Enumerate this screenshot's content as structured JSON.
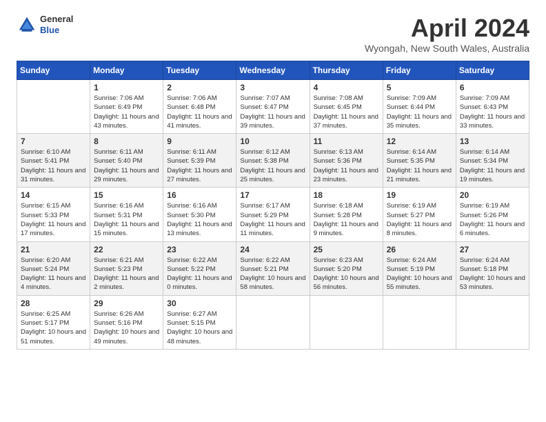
{
  "header": {
    "logo": {
      "general": "General",
      "blue": "Blue"
    },
    "title": "April 2024",
    "location": "Wyongah, New South Wales, Australia"
  },
  "weekdays": [
    "Sunday",
    "Monday",
    "Tuesday",
    "Wednesday",
    "Thursday",
    "Friday",
    "Saturday"
  ],
  "weeks": [
    [
      {
        "day": "",
        "empty": true
      },
      {
        "day": "1",
        "sunrise": "Sunrise: 7:06 AM",
        "sunset": "Sunset: 6:49 PM",
        "daylight": "Daylight: 11 hours and 43 minutes."
      },
      {
        "day": "2",
        "sunrise": "Sunrise: 7:06 AM",
        "sunset": "Sunset: 6:48 PM",
        "daylight": "Daylight: 11 hours and 41 minutes."
      },
      {
        "day": "3",
        "sunrise": "Sunrise: 7:07 AM",
        "sunset": "Sunset: 6:47 PM",
        "daylight": "Daylight: 11 hours and 39 minutes."
      },
      {
        "day": "4",
        "sunrise": "Sunrise: 7:08 AM",
        "sunset": "Sunset: 6:45 PM",
        "daylight": "Daylight: 11 hours and 37 minutes."
      },
      {
        "day": "5",
        "sunrise": "Sunrise: 7:09 AM",
        "sunset": "Sunset: 6:44 PM",
        "daylight": "Daylight: 11 hours and 35 minutes."
      },
      {
        "day": "6",
        "sunrise": "Sunrise: 7:09 AM",
        "sunset": "Sunset: 6:43 PM",
        "daylight": "Daylight: 11 hours and 33 minutes."
      }
    ],
    [
      {
        "day": "7",
        "sunrise": "Sunrise: 6:10 AM",
        "sunset": "Sunset: 5:41 PM",
        "daylight": "Daylight: 11 hours and 31 minutes."
      },
      {
        "day": "8",
        "sunrise": "Sunrise: 6:11 AM",
        "sunset": "Sunset: 5:40 PM",
        "daylight": "Daylight: 11 hours and 29 minutes."
      },
      {
        "day": "9",
        "sunrise": "Sunrise: 6:11 AM",
        "sunset": "Sunset: 5:39 PM",
        "daylight": "Daylight: 11 hours and 27 minutes."
      },
      {
        "day": "10",
        "sunrise": "Sunrise: 6:12 AM",
        "sunset": "Sunset: 5:38 PM",
        "daylight": "Daylight: 11 hours and 25 minutes."
      },
      {
        "day": "11",
        "sunrise": "Sunrise: 6:13 AM",
        "sunset": "Sunset: 5:36 PM",
        "daylight": "Daylight: 11 hours and 23 minutes."
      },
      {
        "day": "12",
        "sunrise": "Sunrise: 6:14 AM",
        "sunset": "Sunset: 5:35 PM",
        "daylight": "Daylight: 11 hours and 21 minutes."
      },
      {
        "day": "13",
        "sunrise": "Sunrise: 6:14 AM",
        "sunset": "Sunset: 5:34 PM",
        "daylight": "Daylight: 11 hours and 19 minutes."
      }
    ],
    [
      {
        "day": "14",
        "sunrise": "Sunrise: 6:15 AM",
        "sunset": "Sunset: 5:33 PM",
        "daylight": "Daylight: 11 hours and 17 minutes."
      },
      {
        "day": "15",
        "sunrise": "Sunrise: 6:16 AM",
        "sunset": "Sunset: 5:31 PM",
        "daylight": "Daylight: 11 hours and 15 minutes."
      },
      {
        "day": "16",
        "sunrise": "Sunrise: 6:16 AM",
        "sunset": "Sunset: 5:30 PM",
        "daylight": "Daylight: 11 hours and 13 minutes."
      },
      {
        "day": "17",
        "sunrise": "Sunrise: 6:17 AM",
        "sunset": "Sunset: 5:29 PM",
        "daylight": "Daylight: 11 hours and 11 minutes."
      },
      {
        "day": "18",
        "sunrise": "Sunrise: 6:18 AM",
        "sunset": "Sunset: 5:28 PM",
        "daylight": "Daylight: 11 hours and 9 minutes."
      },
      {
        "day": "19",
        "sunrise": "Sunrise: 6:19 AM",
        "sunset": "Sunset: 5:27 PM",
        "daylight": "Daylight: 11 hours and 8 minutes."
      },
      {
        "day": "20",
        "sunrise": "Sunrise: 6:19 AM",
        "sunset": "Sunset: 5:26 PM",
        "daylight": "Daylight: 11 hours and 6 minutes."
      }
    ],
    [
      {
        "day": "21",
        "sunrise": "Sunrise: 6:20 AM",
        "sunset": "Sunset: 5:24 PM",
        "daylight": "Daylight: 11 hours and 4 minutes."
      },
      {
        "day": "22",
        "sunrise": "Sunrise: 6:21 AM",
        "sunset": "Sunset: 5:23 PM",
        "daylight": "Daylight: 11 hours and 2 minutes."
      },
      {
        "day": "23",
        "sunrise": "Sunrise: 6:22 AM",
        "sunset": "Sunset: 5:22 PM",
        "daylight": "Daylight: 11 hours and 0 minutes."
      },
      {
        "day": "24",
        "sunrise": "Sunrise: 6:22 AM",
        "sunset": "Sunset: 5:21 PM",
        "daylight": "Daylight: 10 hours and 58 minutes."
      },
      {
        "day": "25",
        "sunrise": "Sunrise: 6:23 AM",
        "sunset": "Sunset: 5:20 PM",
        "daylight": "Daylight: 10 hours and 56 minutes."
      },
      {
        "day": "26",
        "sunrise": "Sunrise: 6:24 AM",
        "sunset": "Sunset: 5:19 PM",
        "daylight": "Daylight: 10 hours and 55 minutes."
      },
      {
        "day": "27",
        "sunrise": "Sunrise: 6:24 AM",
        "sunset": "Sunset: 5:18 PM",
        "daylight": "Daylight: 10 hours and 53 minutes."
      }
    ],
    [
      {
        "day": "28",
        "sunrise": "Sunrise: 6:25 AM",
        "sunset": "Sunset: 5:17 PM",
        "daylight": "Daylight: 10 hours and 51 minutes."
      },
      {
        "day": "29",
        "sunrise": "Sunrise: 6:26 AM",
        "sunset": "Sunset: 5:16 PM",
        "daylight": "Daylight: 10 hours and 49 minutes."
      },
      {
        "day": "30",
        "sunrise": "Sunrise: 6:27 AM",
        "sunset": "Sunset: 5:15 PM",
        "daylight": "Daylight: 10 hours and 48 minutes."
      },
      {
        "day": "",
        "empty": true
      },
      {
        "day": "",
        "empty": true
      },
      {
        "day": "",
        "empty": true
      },
      {
        "day": "",
        "empty": true
      }
    ]
  ]
}
